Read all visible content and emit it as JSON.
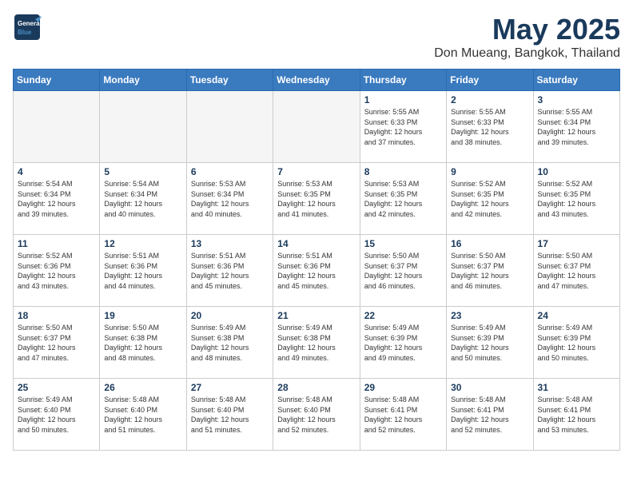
{
  "header": {
    "logo_general": "General",
    "logo_blue": "Blue",
    "month_title": "May 2025",
    "location": "Don Mueang, Bangkok, Thailand"
  },
  "days_of_week": [
    "Sunday",
    "Monday",
    "Tuesday",
    "Wednesday",
    "Thursday",
    "Friday",
    "Saturday"
  ],
  "weeks": [
    [
      {
        "day": "",
        "info": ""
      },
      {
        "day": "",
        "info": ""
      },
      {
        "day": "",
        "info": ""
      },
      {
        "day": "",
        "info": ""
      },
      {
        "day": "1",
        "info": "Sunrise: 5:55 AM\nSunset: 6:33 PM\nDaylight: 12 hours\nand 37 minutes."
      },
      {
        "day": "2",
        "info": "Sunrise: 5:55 AM\nSunset: 6:33 PM\nDaylight: 12 hours\nand 38 minutes."
      },
      {
        "day": "3",
        "info": "Sunrise: 5:55 AM\nSunset: 6:34 PM\nDaylight: 12 hours\nand 39 minutes."
      }
    ],
    [
      {
        "day": "4",
        "info": "Sunrise: 5:54 AM\nSunset: 6:34 PM\nDaylight: 12 hours\nand 39 minutes."
      },
      {
        "day": "5",
        "info": "Sunrise: 5:54 AM\nSunset: 6:34 PM\nDaylight: 12 hours\nand 40 minutes."
      },
      {
        "day": "6",
        "info": "Sunrise: 5:53 AM\nSunset: 6:34 PM\nDaylight: 12 hours\nand 40 minutes."
      },
      {
        "day": "7",
        "info": "Sunrise: 5:53 AM\nSunset: 6:35 PM\nDaylight: 12 hours\nand 41 minutes."
      },
      {
        "day": "8",
        "info": "Sunrise: 5:53 AM\nSunset: 6:35 PM\nDaylight: 12 hours\nand 42 minutes."
      },
      {
        "day": "9",
        "info": "Sunrise: 5:52 AM\nSunset: 6:35 PM\nDaylight: 12 hours\nand 42 minutes."
      },
      {
        "day": "10",
        "info": "Sunrise: 5:52 AM\nSunset: 6:35 PM\nDaylight: 12 hours\nand 43 minutes."
      }
    ],
    [
      {
        "day": "11",
        "info": "Sunrise: 5:52 AM\nSunset: 6:36 PM\nDaylight: 12 hours\nand 43 minutes."
      },
      {
        "day": "12",
        "info": "Sunrise: 5:51 AM\nSunset: 6:36 PM\nDaylight: 12 hours\nand 44 minutes."
      },
      {
        "day": "13",
        "info": "Sunrise: 5:51 AM\nSunset: 6:36 PM\nDaylight: 12 hours\nand 45 minutes."
      },
      {
        "day": "14",
        "info": "Sunrise: 5:51 AM\nSunset: 6:36 PM\nDaylight: 12 hours\nand 45 minutes."
      },
      {
        "day": "15",
        "info": "Sunrise: 5:50 AM\nSunset: 6:37 PM\nDaylight: 12 hours\nand 46 minutes."
      },
      {
        "day": "16",
        "info": "Sunrise: 5:50 AM\nSunset: 6:37 PM\nDaylight: 12 hours\nand 46 minutes."
      },
      {
        "day": "17",
        "info": "Sunrise: 5:50 AM\nSunset: 6:37 PM\nDaylight: 12 hours\nand 47 minutes."
      }
    ],
    [
      {
        "day": "18",
        "info": "Sunrise: 5:50 AM\nSunset: 6:37 PM\nDaylight: 12 hours\nand 47 minutes."
      },
      {
        "day": "19",
        "info": "Sunrise: 5:50 AM\nSunset: 6:38 PM\nDaylight: 12 hours\nand 48 minutes."
      },
      {
        "day": "20",
        "info": "Sunrise: 5:49 AM\nSunset: 6:38 PM\nDaylight: 12 hours\nand 48 minutes."
      },
      {
        "day": "21",
        "info": "Sunrise: 5:49 AM\nSunset: 6:38 PM\nDaylight: 12 hours\nand 49 minutes."
      },
      {
        "day": "22",
        "info": "Sunrise: 5:49 AM\nSunset: 6:39 PM\nDaylight: 12 hours\nand 49 minutes."
      },
      {
        "day": "23",
        "info": "Sunrise: 5:49 AM\nSunset: 6:39 PM\nDaylight: 12 hours\nand 50 minutes."
      },
      {
        "day": "24",
        "info": "Sunrise: 5:49 AM\nSunset: 6:39 PM\nDaylight: 12 hours\nand 50 minutes."
      }
    ],
    [
      {
        "day": "25",
        "info": "Sunrise: 5:49 AM\nSunset: 6:40 PM\nDaylight: 12 hours\nand 50 minutes."
      },
      {
        "day": "26",
        "info": "Sunrise: 5:48 AM\nSunset: 6:40 PM\nDaylight: 12 hours\nand 51 minutes."
      },
      {
        "day": "27",
        "info": "Sunrise: 5:48 AM\nSunset: 6:40 PM\nDaylight: 12 hours\nand 51 minutes."
      },
      {
        "day": "28",
        "info": "Sunrise: 5:48 AM\nSunset: 6:40 PM\nDaylight: 12 hours\nand 52 minutes."
      },
      {
        "day": "29",
        "info": "Sunrise: 5:48 AM\nSunset: 6:41 PM\nDaylight: 12 hours\nand 52 minutes."
      },
      {
        "day": "30",
        "info": "Sunrise: 5:48 AM\nSunset: 6:41 PM\nDaylight: 12 hours\nand 52 minutes."
      },
      {
        "day": "31",
        "info": "Sunrise: 5:48 AM\nSunset: 6:41 PM\nDaylight: 12 hours\nand 53 minutes."
      }
    ]
  ]
}
